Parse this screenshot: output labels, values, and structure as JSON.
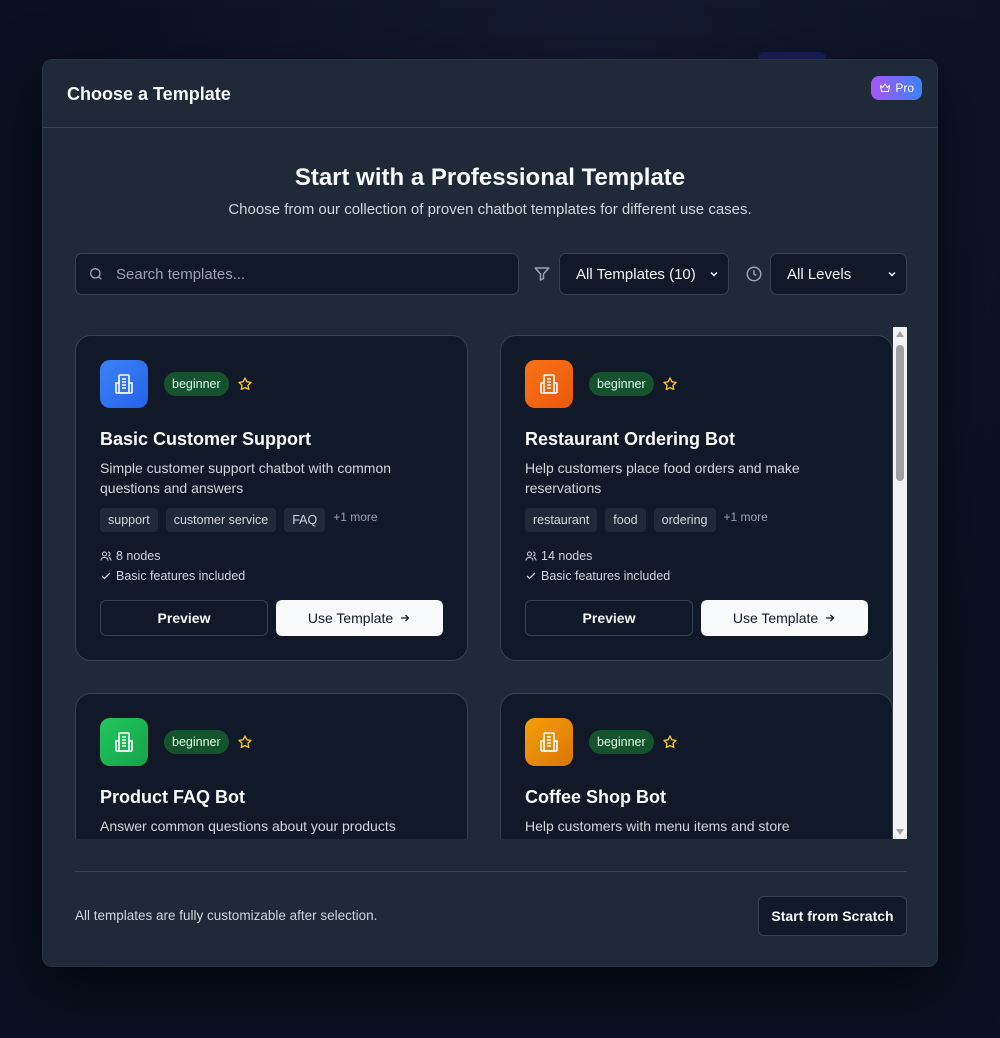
{
  "modal": {
    "title": "Choose a Template",
    "pro_badge": "Pro",
    "hero_title": "Start with a Professional Template",
    "hero_subtitle": "Choose from our collection of proven chatbot templates for different use cases."
  },
  "filters": {
    "search_placeholder": "Search templates...",
    "category_selected": "All Templates (10)",
    "level_selected": "All Levels"
  },
  "colors": {
    "accent_pro_start": "#a855f7",
    "accent_pro_end": "#3b82f6",
    "badge_beginner": "#14532d"
  },
  "templates": [
    {
      "title": "Basic Customer Support",
      "description": "Simple customer support chatbot with common questions and answers",
      "level": "beginner",
      "icon_color": "#3b82f6",
      "icon": "building-icon",
      "tags": [
        "support",
        "customer service",
        "FAQ"
      ],
      "more": "+1 more",
      "nodes": "8 nodes",
      "features": "Basic features included"
    },
    {
      "title": "Restaurant Ordering Bot",
      "description": "Help customers place food orders and make reservations",
      "level": "beginner",
      "icon_color": "#f97316",
      "icon": "building-icon",
      "tags": [
        "restaurant",
        "food",
        "ordering"
      ],
      "more": "+1 more",
      "nodes": "14 nodes",
      "features": "Basic features included"
    },
    {
      "title": "Product FAQ Bot",
      "description": "Answer common questions about your products",
      "level": "beginner",
      "icon_color": "#22c55e",
      "icon": "building-icon"
    },
    {
      "title": "Coffee Shop Bot",
      "description": "Help customers with menu items and store information",
      "level": "beginner",
      "icon_color": "#f59e0b",
      "icon": "building-icon"
    }
  ],
  "buttons": {
    "preview": "Preview",
    "use_template": "Use Template"
  },
  "footer": {
    "note": "All templates are fully customizable after selection.",
    "scratch_button": "Start from Scratch"
  }
}
